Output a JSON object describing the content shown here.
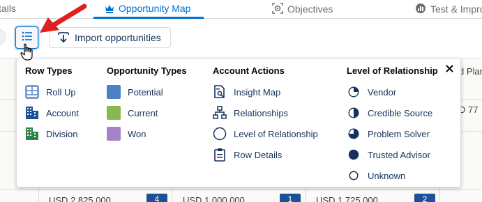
{
  "tabs": [
    {
      "label": "tails",
      "icon": "none"
    },
    {
      "label": "Opportunity Map",
      "icon": "crown-icon"
    },
    {
      "label": "Objectives",
      "icon": "target-icon"
    },
    {
      "label": "Test & Improv",
      "icon": "gauge-icon"
    }
  ],
  "toolbar": {
    "import_label": "Import opportunities"
  },
  "grid": {
    "right_cells": [
      "d Plar",
      "D 77"
    ],
    "amounts": [
      "USD 2,825,000",
      "USD 1,000,000",
      "USD 1,725,000"
    ],
    "badges": [
      "4",
      "1",
      "2"
    ]
  },
  "legend": {
    "row_types": {
      "title": "Row Types",
      "items": [
        {
          "label": "Roll Up",
          "icon": "roll-up-icon"
        },
        {
          "label": "Account",
          "icon": "account-icon"
        },
        {
          "label": "Division",
          "icon": "division-icon"
        }
      ]
    },
    "opportunity_types": {
      "title": "Opportunity Types",
      "items": [
        {
          "label": "Potential",
          "color": "#4c80c7"
        },
        {
          "label": "Current",
          "color": "#87b953"
        },
        {
          "label": "Won",
          "color": "#a783c5"
        }
      ]
    },
    "account_actions": {
      "title": "Account Actions",
      "items": [
        {
          "label": "Insight Map",
          "icon": "insight-map-icon"
        },
        {
          "label": "Relationships",
          "icon": "hierarchy-icon"
        },
        {
          "label": "Level of Relationship",
          "icon": "circle-icon"
        },
        {
          "label": "Row Details",
          "icon": "clipboard-icon"
        }
      ]
    },
    "level_of_relationship": {
      "title": "Level of Relationship",
      "items": [
        {
          "label": "Vendor",
          "icon": "quarter-circle-icon"
        },
        {
          "label": "Credible Source",
          "icon": "half-circle-icon"
        },
        {
          "label": "Problem Solver",
          "icon": "three-quarter-circle-icon"
        },
        {
          "label": "Trusted Advisor",
          "icon": "full-circle-icon"
        },
        {
          "label": "Unknown",
          "icon": "empty-circle-icon"
        }
      ]
    }
  }
}
